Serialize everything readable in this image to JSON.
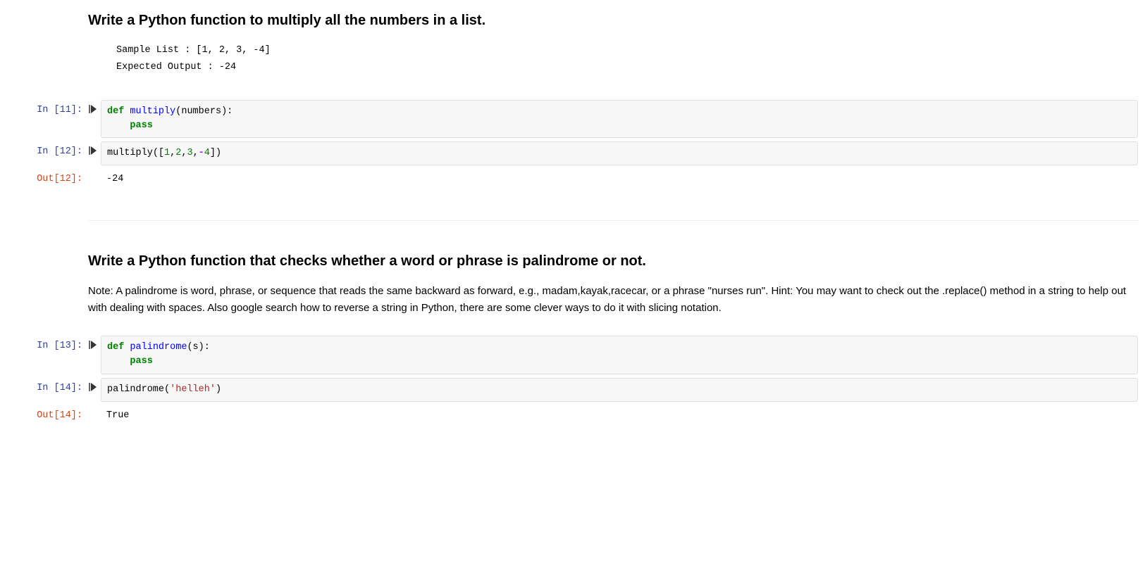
{
  "section1": {
    "heading": "Write a Python function to multiply all the numbers in a list.",
    "sample_list_label": "Sample List : [1, 2, 3, -4]",
    "expected_label": "Expected Output : -24"
  },
  "cell11": {
    "prompt": "In [11]:",
    "code": {
      "kw_def": "def",
      "fn_name": "multiply",
      "params_open": "(",
      "params": "numbers",
      "params_close": "):",
      "indent": "    ",
      "kw_pass": "pass"
    }
  },
  "cell12": {
    "prompt": "In [12]:",
    "code": {
      "call": "multiply",
      "open": "([",
      "n1": "1",
      "c": ",",
      "n2": "2",
      "n3": "3",
      "minus": "-",
      "n4": "4",
      "close": "])"
    },
    "out_prompt": "Out[12]:",
    "out_value": "-24"
  },
  "section2": {
    "heading": "Write a Python function that checks whether a word or phrase is palindrome or not.",
    "note": "Note: A palindrome is word, phrase, or sequence that reads the same backward as forward, e.g., madam,kayak,racecar, or a phrase \"nurses run\". Hint: You may want to check out the .replace() method in a string to help out with dealing with spaces. Also google search how to reverse a string in Python, there are some clever ways to do it with slicing notation."
  },
  "cell13": {
    "prompt": "In [13]:",
    "code": {
      "kw_def": "def",
      "fn_name": "palindrome",
      "params_open": "(",
      "params": "s",
      "params_close": "):",
      "indent": "    ",
      "kw_pass": "pass"
    }
  },
  "cell14": {
    "prompt": "In [14]:",
    "code": {
      "call": "palindrome",
      "open": "(",
      "str": "'helleh'",
      "close": ")"
    },
    "out_prompt": "Out[14]:",
    "out_value": "True"
  }
}
